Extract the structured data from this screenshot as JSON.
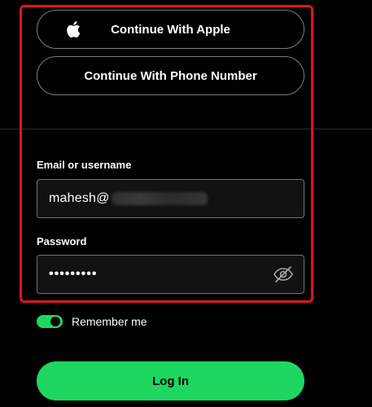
{
  "social": {
    "apple_label": "Continue With Apple",
    "phone_label": "Continue With Phone Number"
  },
  "form": {
    "email_label": "Email or username",
    "email_value": "mahesh@",
    "password_label": "Password",
    "password_value": "•••••••••"
  },
  "remember": {
    "label": "Remember me",
    "checked": true
  },
  "login": {
    "label": "Log In"
  },
  "colors": {
    "accent": "#1ed760",
    "highlight": "#e3131e",
    "background": "#000000"
  },
  "icons": {
    "apple": "apple-icon",
    "password_toggle": "eye-slash-icon"
  }
}
